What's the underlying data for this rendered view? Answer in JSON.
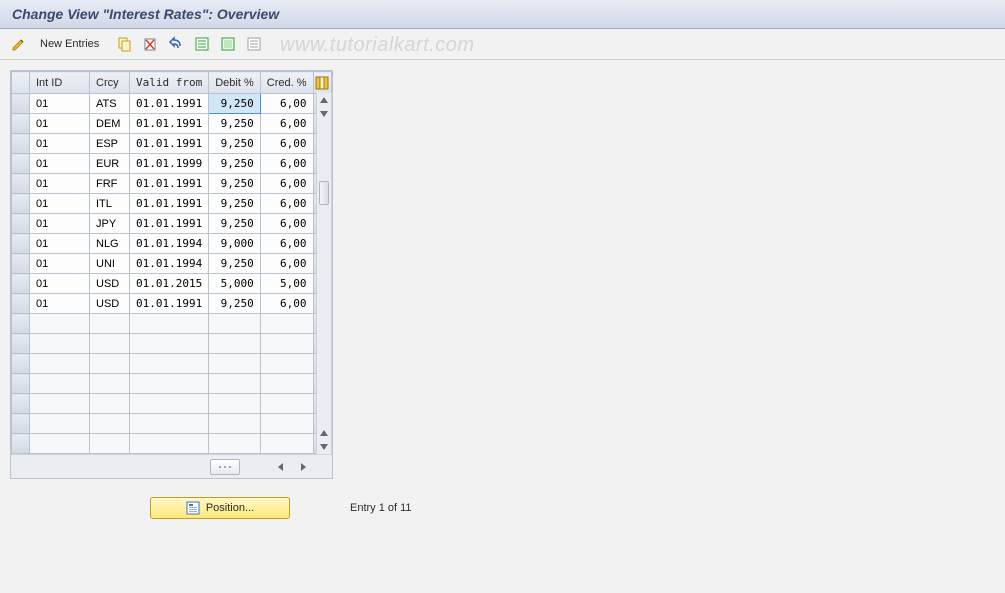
{
  "title": "Change View \"Interest Rates\": Overview",
  "watermark": "www.tutorialkart.com",
  "toolbar": {
    "new_entries_label": "New Entries"
  },
  "table": {
    "headers": {
      "int_id": "Int ID",
      "crcy": "Crcy",
      "valid_from": "Valid from",
      "debit": "Debit %",
      "cred": "Cred. %"
    },
    "rows": [
      {
        "int_id": "01",
        "crcy": "ATS",
        "valid_from": "01.01.1991",
        "debit": "9,250",
        "cred": "6,00",
        "selected": true
      },
      {
        "int_id": "01",
        "crcy": "DEM",
        "valid_from": "01.01.1991",
        "debit": "9,250",
        "cred": "6,00"
      },
      {
        "int_id": "01",
        "crcy": "ESP",
        "valid_from": "01.01.1991",
        "debit": "9,250",
        "cred": "6,00"
      },
      {
        "int_id": "01",
        "crcy": "EUR",
        "valid_from": "01.01.1999",
        "debit": "9,250",
        "cred": "6,00"
      },
      {
        "int_id": "01",
        "crcy": "FRF",
        "valid_from": "01.01.1991",
        "debit": "9,250",
        "cred": "6,00"
      },
      {
        "int_id": "01",
        "crcy": "ITL",
        "valid_from": "01.01.1991",
        "debit": "9,250",
        "cred": "6,00"
      },
      {
        "int_id": "01",
        "crcy": "JPY",
        "valid_from": "01.01.1991",
        "debit": "9,250",
        "cred": "6,00"
      },
      {
        "int_id": "01",
        "crcy": "NLG",
        "valid_from": "01.01.1994",
        "debit": "9,000",
        "cred": "6,00"
      },
      {
        "int_id": "01",
        "crcy": "UNI",
        "valid_from": "01.01.1994",
        "debit": "9,250",
        "cred": "6,00"
      },
      {
        "int_id": "01",
        "crcy": "USD",
        "valid_from": "01.01.2015",
        "debit": "5,000",
        "cred": "5,00"
      },
      {
        "int_id": "01",
        "crcy": "USD",
        "valid_from": "01.01.1991",
        "debit": "9,250",
        "cred": "6,00"
      }
    ],
    "empty_rows": 7
  },
  "footer": {
    "position_label": "Position...",
    "entry_status": "Entry 1 of 11"
  }
}
